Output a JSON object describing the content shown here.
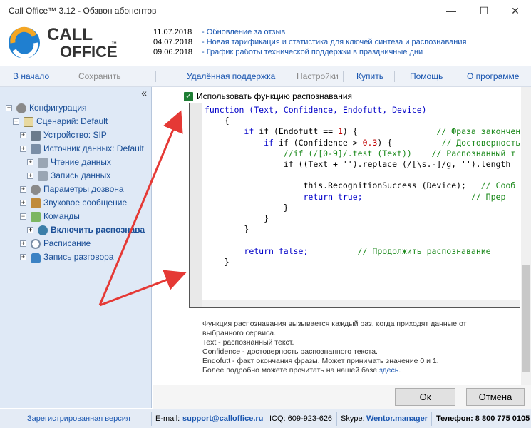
{
  "window": {
    "title": "Call Office™ 3.12 - Обзвон абонентов",
    "minimize_icon": "minimize-icon",
    "maximize_icon": "maximize-icon",
    "close_icon": "close-icon"
  },
  "logo": {
    "line1": "CALL",
    "line2": "OFFICE",
    "tm": "™"
  },
  "news": [
    {
      "date": "11.07.2018",
      "text": "- Обновление за отзыв"
    },
    {
      "date": "04.07.2018",
      "text": "- Новая тарификация и статистика для ключей синтеза и распознавания"
    },
    {
      "date": "09.06.2018",
      "text": "- График работы технической поддержки в праздничные дни"
    }
  ],
  "toolbar": {
    "home": "В начало",
    "save": "Сохранить",
    "remote": "Удалённая поддержка",
    "settings": "Настройки",
    "buy": "Купить",
    "help": "Помощь",
    "about": "О программе"
  },
  "sidebar": {
    "collapse": "«",
    "items": [
      {
        "label": "Конфигурация",
        "icon": "gear-icon"
      },
      {
        "label": "Сценарий: Default",
        "icon": "script-icon"
      },
      {
        "label": "Устройство: SIP",
        "icon": "device-icon"
      },
      {
        "label": "Источник данных: Default",
        "icon": "database-icon"
      },
      {
        "label": "Чтение данных",
        "icon": "read-data-icon"
      },
      {
        "label": "Запись данных",
        "icon": "write-data-icon"
      },
      {
        "label": "Параметры дозвона",
        "icon": "gear-icon"
      },
      {
        "label": "Звуковое сообщение",
        "icon": "speaker-icon"
      },
      {
        "label": "Команды",
        "icon": "commands-icon"
      },
      {
        "label": "Включить распознава",
        "icon": "recognition-icon"
      },
      {
        "label": "Расписание",
        "icon": "clock-icon"
      },
      {
        "label": "Запись разговора",
        "icon": "microphone-icon"
      }
    ]
  },
  "main": {
    "checkbox_label": "Использовать функцию распознавания",
    "code": {
      "l1": "function (Text, Confidence, Endofutt, Device)",
      "l2": "{",
      "l3a": "if (Endofutt == ",
      "l3n": "1",
      "l3b": ") {",
      "l3c": "// Фраза закончен",
      "l4a": "if (Confidence > ",
      "l4n": "0.3",
      "l4b": ") {",
      "l4c": "// Достоверность",
      "l5a": "//if (/[0-9]/.test (Text))",
      "l5c": "// Распознанный т",
      "l6": "if ((Text + '').replace (/[\\s.-]/g, '').length",
      "l7a": "this.RecognitionSuccess (Device);",
      "l7c": "// Сооб",
      "l8a": "return true;",
      "l8c": "// Прер",
      "l9": "}",
      "l10": "}",
      "l11": "}",
      "l12a": "return false;",
      "l12c": "// Продолжить распознавание",
      "l13": "}"
    },
    "description": [
      "Функция распознавания вызывается каждый раз, когда приходят данные от",
      "выбранного сервиса.",
      "Text - распознанный текст.",
      "Confidence - достоверность распознанного текста.",
      "Endofutt - факт окончания фразы. Может принимать значение 0 и 1.",
      "Более подробно можете прочитать на нашей базе "
    ],
    "description_link": "здесь",
    "description_tail": "."
  },
  "buttons": {
    "ok": "Ок",
    "cancel": "Отмена"
  },
  "status": {
    "registered": "Зарегистрированная версия",
    "email_label": "E-mail:",
    "email": "support@calloffice.ru",
    "icq": "ICQ: 609-923-626",
    "skype_label": "Skype:",
    "skype": "Wentor.manager",
    "phone": "Телефон: 8 800 775 0105"
  },
  "colors": {
    "accent": "#1a56b0",
    "arrow": "#e53935",
    "sidebar_bg": "#dfe9f6"
  }
}
